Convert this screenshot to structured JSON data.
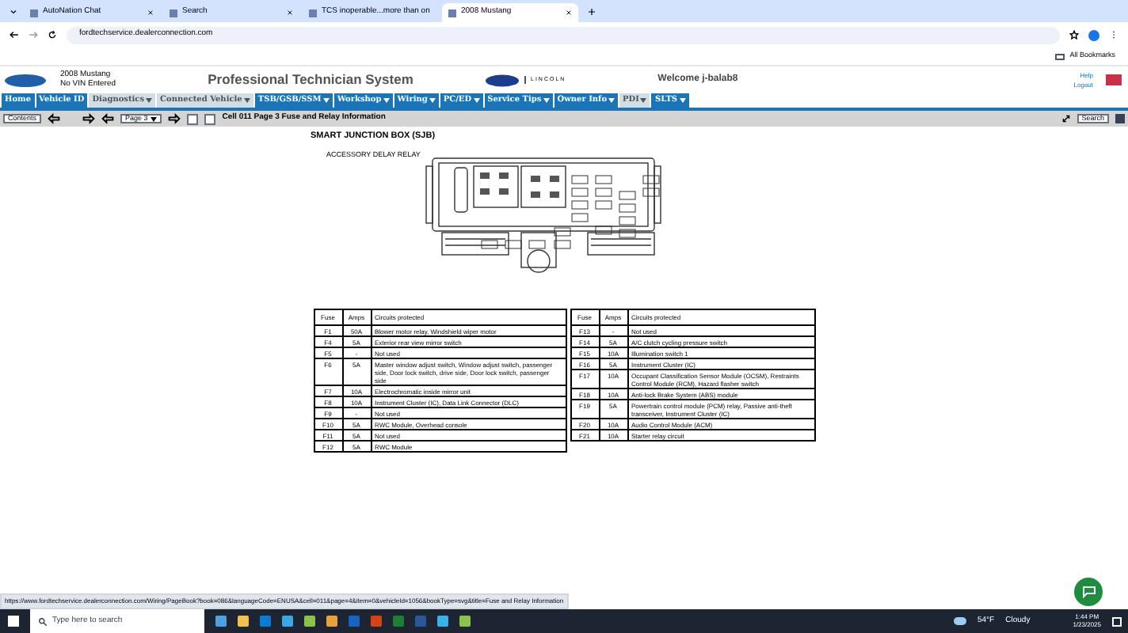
{
  "browser": {
    "tabs": [
      {
        "title": "AutoNation Chat",
        "selected": false
      },
      {
        "title": "Search",
        "selected": false
      },
      {
        "title": "TCS inoperable...more than on",
        "selected": false
      },
      {
        "title": "2008 Mustang",
        "selected": true
      }
    ],
    "url": "fordtechservice.dealerconnection.com",
    "bookmarks_label": "All Bookmarks"
  },
  "header": {
    "vehicle_model": "2008 Mustang",
    "vin_status": "No VIN Entered",
    "title": "Professional Technician System",
    "brand_text": "LINCOLN",
    "welcome": "Welcome j-balab8",
    "links": [
      "Help",
      "Logout"
    ]
  },
  "nav": [
    {
      "label": "Home",
      "has_menu": false,
      "disabled": false
    },
    {
      "label": "Vehicle ID",
      "has_menu": false,
      "disabled": false
    },
    {
      "label": "Diagnostics",
      "has_menu": true,
      "disabled": true
    },
    {
      "label": "Connected Vehicle",
      "has_menu": true,
      "disabled": true
    },
    {
      "label": "TSB/GSB/SSM",
      "has_menu": true,
      "disabled": false
    },
    {
      "label": "Workshop",
      "has_menu": true,
      "disabled": false
    },
    {
      "label": "Wiring",
      "has_menu": true,
      "disabled": false
    },
    {
      "label": "PC/ED",
      "has_menu": true,
      "disabled": false
    },
    {
      "label": "Service Tips",
      "has_menu": true,
      "disabled": false
    },
    {
      "label": "Owner Info",
      "has_menu": true,
      "disabled": false
    },
    {
      "label": "PDI",
      "has_menu": true,
      "disabled": true
    },
    {
      "label": "SLTS",
      "has_menu": true,
      "disabled": false
    }
  ],
  "toolbar": {
    "contents": "Contents",
    "page": "Page 3",
    "title": "Cell 011 Page 3 Fuse and Relay Information",
    "search": "Search"
  },
  "diagram": {
    "title": "SMART JUNCTION BOX (SJB)",
    "callout": "ACCESSORY DELAY RELAY"
  },
  "tables": [
    {
      "columns": [
        "Fuse",
        "Amps",
        "Circuits protected"
      ],
      "rows": [
        [
          "F1",
          "50A",
          "Blower motor relay, Windshield wiper motor"
        ],
        [
          "F4",
          "5A",
          "Exterior rear view mirror switch"
        ],
        [
          "F5",
          "-",
          "Not used"
        ],
        [
          "F6",
          "5A",
          "Master window adjust switch, Window adjust switch, passenger side, Door lock switch, drive side, Door lock switch, passenger side"
        ],
        [
          "F7",
          "10A",
          "Electrochromatic inside mirror unit"
        ],
        [
          "F8",
          "10A",
          "Instrument Cluster (IC), Data Link Connector (DLC)"
        ],
        [
          "F9",
          "-",
          "Not used"
        ],
        [
          "F10",
          "5A",
          "RWC Module, Overhead console"
        ],
        [
          "F11",
          "5A",
          "Not used"
        ],
        [
          "F12",
          "5A",
          "RWC Module"
        ]
      ]
    },
    {
      "columns": [
        "Fuse",
        "Amps",
        "Circuits protected"
      ],
      "rows": [
        [
          "F13",
          "-",
          "Not used"
        ],
        [
          "F14",
          "5A",
          "A/C clutch cycling pressure switch"
        ],
        [
          "F15",
          "10A",
          "Illumination switch 1"
        ],
        [
          "F16",
          "5A",
          "Instrument Cluster (IC)"
        ],
        [
          "F17",
          "10A",
          "Occupant Classification Sensor Module (OCSM), Restraints Control Module (RCM), Hazard flasher switch"
        ],
        [
          "F18",
          "10A",
          "Anti-lock Brake System (ABS) module"
        ],
        [
          "F19",
          "5A",
          "Powertrain control module (PCM) relay, Passive anti-theft transceiver, Instrument Cluster (IC)"
        ],
        [
          "F20",
          "10A",
          "Audio Control Module (ACM)"
        ],
        [
          "F21",
          "10A",
          "Starter relay circuit"
        ]
      ]
    }
  ],
  "status_url": "https://www.fordtechservice.dealerconnection.com/Wiring/PageBook?book=086&languageCode=ENUSA&cell=011&page=4&item=0&vehicleId=1056&bookType=svg&title=Fuse and Relay Information",
  "taskbar": {
    "search_placeholder": "Type here to search",
    "temperature": "54°F",
    "condition": "Cloudy",
    "time": "1:44 PM",
    "date": "1/23/2025"
  }
}
